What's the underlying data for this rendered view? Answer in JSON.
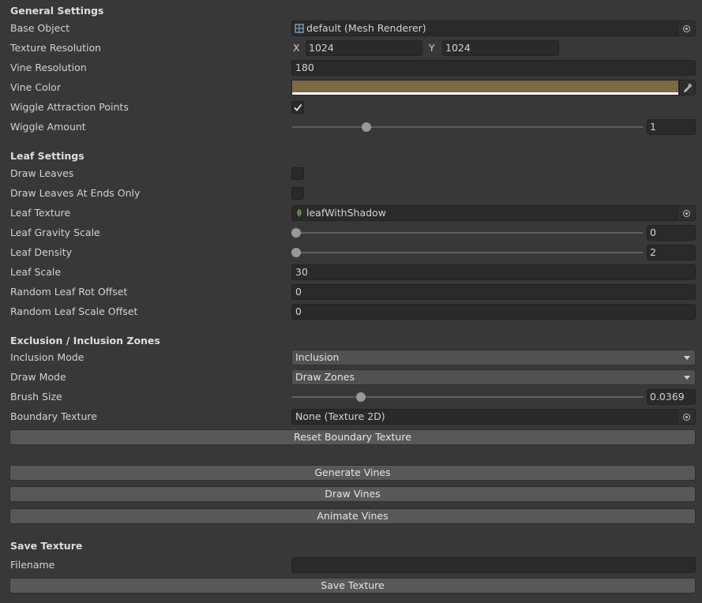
{
  "general": {
    "header": "General Settings",
    "base_object": {
      "label": "Base Object",
      "value": "default (Mesh Renderer)",
      "icon": "mesh-renderer-icon"
    },
    "texture_resolution": {
      "label": "Texture Resolution",
      "x_label": "X",
      "x": "1024",
      "y_label": "Y",
      "y": "1024"
    },
    "vine_resolution": {
      "label": "Vine Resolution",
      "value": "180"
    },
    "vine_color": {
      "label": "Vine Color",
      "color": "#7c6a45",
      "icon": "eyedropper-icon"
    },
    "wiggle_attraction": {
      "label": "Wiggle Attraction Points",
      "checked": true
    },
    "wiggle_amount": {
      "label": "Wiggle Amount",
      "value": "1",
      "fraction": 0.205
    }
  },
  "leaf": {
    "header": "Leaf Settings",
    "draw_leaves": {
      "label": "Draw Leaves",
      "checked": false
    },
    "draw_leaves_ends": {
      "label": "Draw Leaves At Ends Only",
      "checked": false
    },
    "leaf_texture": {
      "label": "Leaf Texture",
      "value": "leafWithShadow",
      "icon": "texture-leaf-icon"
    },
    "gravity_scale": {
      "label": "Leaf Gravity Scale",
      "value": "0",
      "fraction": 0
    },
    "density": {
      "label": "Leaf Density",
      "value": "2",
      "fraction": 0
    },
    "scale": {
      "label": "Leaf Scale",
      "value": "30"
    },
    "rot_offset": {
      "label": "Random Leaf Rot Offset",
      "value": "0"
    },
    "scale_offset": {
      "label": "Random Leaf Scale Offset",
      "value": "0"
    }
  },
  "zones": {
    "header": "Exclusion / Inclusion Zones",
    "inclusion_mode": {
      "label": "Inclusion Mode",
      "value": "Inclusion"
    },
    "draw_mode": {
      "label": "Draw Mode",
      "value": "Draw Zones"
    },
    "brush_size": {
      "label": "Brush Size",
      "value": "0.0369",
      "fraction": 0.19
    },
    "boundary_texture": {
      "label": "Boundary Texture",
      "value": "None (Texture 2D)"
    },
    "reset_button": "Reset Boundary Texture"
  },
  "actions": {
    "generate": "Generate Vines",
    "draw": "Draw Vines",
    "animate": "Animate Vines"
  },
  "save": {
    "header": "Save Texture",
    "filename": {
      "label": "Filename",
      "value": ""
    },
    "save_button": "Save Texture"
  }
}
